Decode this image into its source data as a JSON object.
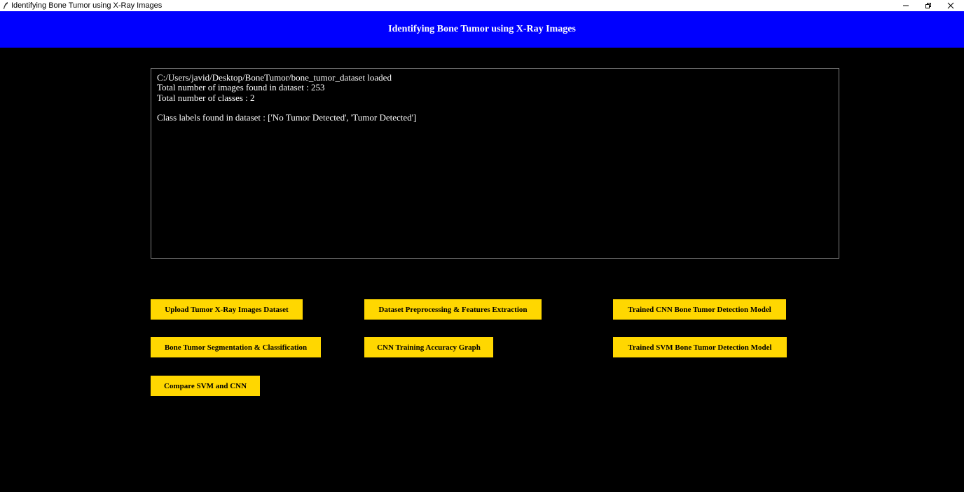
{
  "window": {
    "title": "Identifying Bone Tumor using X-Ray Images",
    "icon": "feather-icon",
    "controls": [
      "minimize-icon",
      "restore-icon",
      "close-icon"
    ]
  },
  "header": {
    "title": "Identifying Bone Tumor using X-Ray Images",
    "background_color": "#0000ff",
    "text_color": "#ffffff"
  },
  "output": {
    "lines": [
      "C:/Users/javid/Desktop/BoneTumor/bone_tumor_dataset loaded",
      "Total number of images found in dataset : 253",
      "Total number of classes : 2",
      "",
      "Class labels found in dataset : ['No Tumor Detected', 'Tumor Detected']"
    ]
  },
  "buttons": [
    {
      "label": "Upload Tumor X-Ray Images Dataset"
    },
    {
      "label": "Dataset Preprocessing & Features Extraction"
    },
    {
      "label": "Trained CNN Bone Tumor Detection Model"
    },
    {
      "label": "Bone Tumor Segmentation & Classification"
    },
    {
      "label": "CNN Training Accuracy Graph"
    },
    {
      "label": "Trained SVM Bone Tumor Detection Model"
    },
    {
      "label": "Compare SVM and CNN"
    }
  ],
  "colors": {
    "background": "#000000",
    "button_background": "#ffd700",
    "button_text": "#000000"
  }
}
